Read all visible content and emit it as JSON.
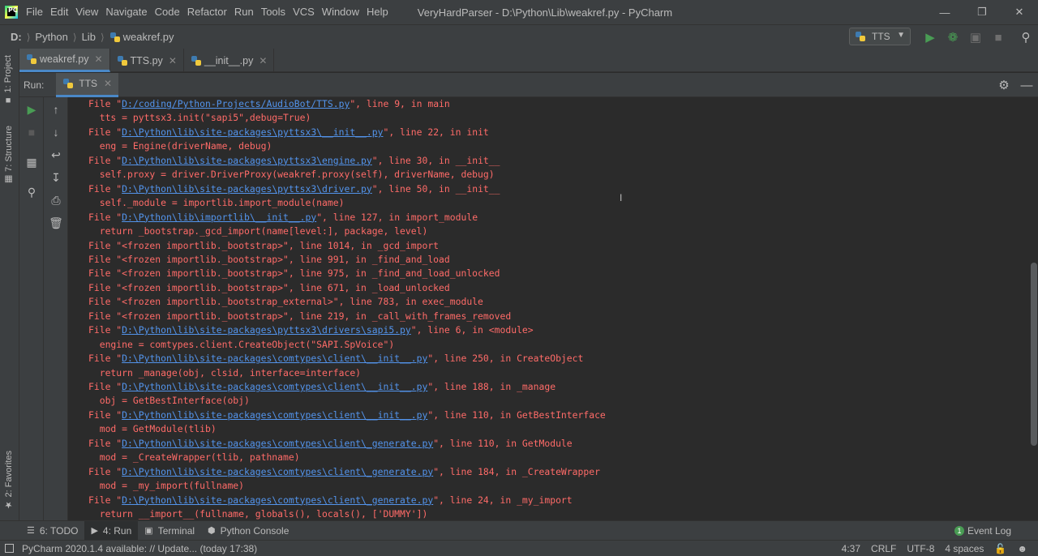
{
  "menu": [
    "File",
    "Edit",
    "View",
    "Navigate",
    "Code",
    "Refactor",
    "Run",
    "Tools",
    "VCS",
    "Window",
    "Help"
  ],
  "window_title": "VeryHardParser - D:\\Python\\Lib\\weakref.py - PyCharm",
  "breadcrumb": {
    "drive": "D:",
    "items": [
      "Python",
      "Lib"
    ],
    "file": "weakref.py"
  },
  "run_config": "TTS",
  "tabs": [
    {
      "label": "weakref.py",
      "active": true
    },
    {
      "label": "TTS.py",
      "active": false
    },
    {
      "label": "__init__.py",
      "active": false
    }
  ],
  "side_tabs": {
    "project": "1: Project",
    "structure": "7: Structure",
    "favorites": "2: Favorites"
  },
  "run_panel": {
    "label": "Run:",
    "tab": "TTS"
  },
  "console": [
    {
      "pre": "File \"",
      "link": "D:/coding/Python-Projects/AudioBot/TTS.py",
      "post": "\", line 9, in main"
    },
    {
      "pre": "  tts = pyttsx3.init(\"sapi5\",debug=True)",
      "link": "",
      "post": ""
    },
    {
      "pre": "File \"",
      "link": "D:\\Python\\lib\\site-packages\\pyttsx3\\__init__.py",
      "post": "\", line 22, in init"
    },
    {
      "pre": "  eng = Engine(driverName, debug)",
      "link": "",
      "post": ""
    },
    {
      "pre": "File \"",
      "link": "D:\\Python\\lib\\site-packages\\pyttsx3\\engine.py",
      "post": "\", line 30, in __init__"
    },
    {
      "pre": "  self.proxy = driver.DriverProxy(weakref.proxy(self), driverName, debug)",
      "link": "",
      "post": ""
    },
    {
      "pre": "File \"",
      "link": "D:\\Python\\lib\\site-packages\\pyttsx3\\driver.py",
      "post": "\", line 50, in __init__"
    },
    {
      "pre": "  self._module = importlib.import_module(name)",
      "link": "",
      "post": ""
    },
    {
      "pre": "File \"",
      "link": "D:\\Python\\lib\\importlib\\__init__.py",
      "post": "\", line 127, in import_module"
    },
    {
      "pre": "  return _bootstrap._gcd_import(name[level:], package, level)",
      "link": "",
      "post": ""
    },
    {
      "pre": "File \"<frozen importlib._bootstrap>\", line 1014, in _gcd_import",
      "link": "",
      "post": ""
    },
    {
      "pre": "File \"<frozen importlib._bootstrap>\", line 991, in _find_and_load",
      "link": "",
      "post": ""
    },
    {
      "pre": "File \"<frozen importlib._bootstrap>\", line 975, in _find_and_load_unlocked",
      "link": "",
      "post": ""
    },
    {
      "pre": "File \"<frozen importlib._bootstrap>\", line 671, in _load_unlocked",
      "link": "",
      "post": ""
    },
    {
      "pre": "File \"<frozen importlib._bootstrap_external>\", line 783, in exec_module",
      "link": "",
      "post": ""
    },
    {
      "pre": "File \"<frozen importlib._bootstrap>\", line 219, in _call_with_frames_removed",
      "link": "",
      "post": ""
    },
    {
      "pre": "File \"",
      "link": "D:\\Python\\lib\\site-packages\\pyttsx3\\drivers\\sapi5.py",
      "post": "\", line 6, in <module>"
    },
    {
      "pre": "  engine = comtypes.client.CreateObject(\"SAPI.SpVoice\")",
      "link": "",
      "post": ""
    },
    {
      "pre": "File \"",
      "link": "D:\\Python\\lib\\site-packages\\comtypes\\client\\__init__.py",
      "post": "\", line 250, in CreateObject"
    },
    {
      "pre": "  return _manage(obj, clsid, interface=interface)",
      "link": "",
      "post": ""
    },
    {
      "pre": "File \"",
      "link": "D:\\Python\\lib\\site-packages\\comtypes\\client\\__init__.py",
      "post": "\", line 188, in _manage"
    },
    {
      "pre": "  obj = GetBestInterface(obj)",
      "link": "",
      "post": ""
    },
    {
      "pre": "File \"",
      "link": "D:\\Python\\lib\\site-packages\\comtypes\\client\\__init__.py",
      "post": "\", line 110, in GetBestInterface"
    },
    {
      "pre": "  mod = GetModule(tlib)",
      "link": "",
      "post": ""
    },
    {
      "pre": "File \"",
      "link": "D:\\Python\\lib\\site-packages\\comtypes\\client\\_generate.py",
      "post": "\", line 110, in GetModule"
    },
    {
      "pre": "  mod = _CreateWrapper(tlib, pathname)",
      "link": "",
      "post": ""
    },
    {
      "pre": "File \"",
      "link": "D:\\Python\\lib\\site-packages\\comtypes\\client\\_generate.py",
      "post": "\", line 184, in _CreateWrapper"
    },
    {
      "pre": "  mod = _my_import(fullname)",
      "link": "",
      "post": ""
    },
    {
      "pre": "File \"",
      "link": "D:\\Python\\lib\\site-packages\\comtypes\\client\\_generate.py",
      "post": "\", line 24, in _my_import"
    },
    {
      "pre": "  return __import__(fullname, globals(), locals(), ['DUMMY'])",
      "link": "",
      "post": ""
    }
  ],
  "bottom_tabs": [
    {
      "label": "6: TODO",
      "icon": "list-icon",
      "active": false
    },
    {
      "label": "4: Run",
      "icon": "run-icon",
      "active": true
    },
    {
      "label": "Terminal",
      "icon": "terminal-icon",
      "active": false
    },
    {
      "label": "Python Console",
      "icon": "python-icon",
      "active": false
    }
  ],
  "event_log": {
    "label": "Event Log",
    "count": "1"
  },
  "status": {
    "message": "PyCharm 2020.1.4 available: // Update... (today 17:38)",
    "position": "4:37",
    "line_sep": "CRLF",
    "encoding": "UTF-8",
    "indent": "4 spaces"
  },
  "colors": {
    "error_text": "#ff6b68",
    "link": "#5394ec",
    "run_green": "#499c54",
    "accent": "#4a88c7"
  }
}
